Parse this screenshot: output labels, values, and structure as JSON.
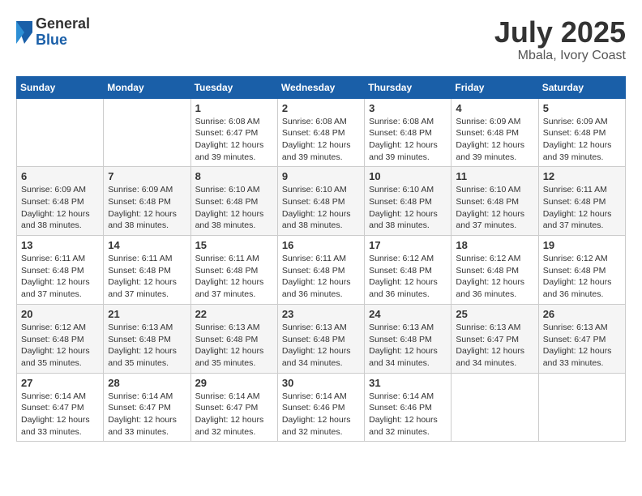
{
  "logo": {
    "general": "General",
    "blue": "Blue"
  },
  "header": {
    "month": "July 2025",
    "location": "Mbala, Ivory Coast"
  },
  "weekdays": [
    "Sunday",
    "Monday",
    "Tuesday",
    "Wednesday",
    "Thursday",
    "Friday",
    "Saturday"
  ],
  "weeks": [
    [
      {
        "day": "",
        "info": ""
      },
      {
        "day": "",
        "info": ""
      },
      {
        "day": "1",
        "info": "Sunrise: 6:08 AM\nSunset: 6:47 PM\nDaylight: 12 hours and 39 minutes."
      },
      {
        "day": "2",
        "info": "Sunrise: 6:08 AM\nSunset: 6:48 PM\nDaylight: 12 hours and 39 minutes."
      },
      {
        "day": "3",
        "info": "Sunrise: 6:08 AM\nSunset: 6:48 PM\nDaylight: 12 hours and 39 minutes."
      },
      {
        "day": "4",
        "info": "Sunrise: 6:09 AM\nSunset: 6:48 PM\nDaylight: 12 hours and 39 minutes."
      },
      {
        "day": "5",
        "info": "Sunrise: 6:09 AM\nSunset: 6:48 PM\nDaylight: 12 hours and 39 minutes."
      }
    ],
    [
      {
        "day": "6",
        "info": "Sunrise: 6:09 AM\nSunset: 6:48 PM\nDaylight: 12 hours and 38 minutes."
      },
      {
        "day": "7",
        "info": "Sunrise: 6:09 AM\nSunset: 6:48 PM\nDaylight: 12 hours and 38 minutes."
      },
      {
        "day": "8",
        "info": "Sunrise: 6:10 AM\nSunset: 6:48 PM\nDaylight: 12 hours and 38 minutes."
      },
      {
        "day": "9",
        "info": "Sunrise: 6:10 AM\nSunset: 6:48 PM\nDaylight: 12 hours and 38 minutes."
      },
      {
        "day": "10",
        "info": "Sunrise: 6:10 AM\nSunset: 6:48 PM\nDaylight: 12 hours and 38 minutes."
      },
      {
        "day": "11",
        "info": "Sunrise: 6:10 AM\nSunset: 6:48 PM\nDaylight: 12 hours and 37 minutes."
      },
      {
        "day": "12",
        "info": "Sunrise: 6:11 AM\nSunset: 6:48 PM\nDaylight: 12 hours and 37 minutes."
      }
    ],
    [
      {
        "day": "13",
        "info": "Sunrise: 6:11 AM\nSunset: 6:48 PM\nDaylight: 12 hours and 37 minutes."
      },
      {
        "day": "14",
        "info": "Sunrise: 6:11 AM\nSunset: 6:48 PM\nDaylight: 12 hours and 37 minutes."
      },
      {
        "day": "15",
        "info": "Sunrise: 6:11 AM\nSunset: 6:48 PM\nDaylight: 12 hours and 37 minutes."
      },
      {
        "day": "16",
        "info": "Sunrise: 6:11 AM\nSunset: 6:48 PM\nDaylight: 12 hours and 36 minutes."
      },
      {
        "day": "17",
        "info": "Sunrise: 6:12 AM\nSunset: 6:48 PM\nDaylight: 12 hours and 36 minutes."
      },
      {
        "day": "18",
        "info": "Sunrise: 6:12 AM\nSunset: 6:48 PM\nDaylight: 12 hours and 36 minutes."
      },
      {
        "day": "19",
        "info": "Sunrise: 6:12 AM\nSunset: 6:48 PM\nDaylight: 12 hours and 36 minutes."
      }
    ],
    [
      {
        "day": "20",
        "info": "Sunrise: 6:12 AM\nSunset: 6:48 PM\nDaylight: 12 hours and 35 minutes."
      },
      {
        "day": "21",
        "info": "Sunrise: 6:13 AM\nSunset: 6:48 PM\nDaylight: 12 hours and 35 minutes."
      },
      {
        "day": "22",
        "info": "Sunrise: 6:13 AM\nSunset: 6:48 PM\nDaylight: 12 hours and 35 minutes."
      },
      {
        "day": "23",
        "info": "Sunrise: 6:13 AM\nSunset: 6:48 PM\nDaylight: 12 hours and 34 minutes."
      },
      {
        "day": "24",
        "info": "Sunrise: 6:13 AM\nSunset: 6:48 PM\nDaylight: 12 hours and 34 minutes."
      },
      {
        "day": "25",
        "info": "Sunrise: 6:13 AM\nSunset: 6:47 PM\nDaylight: 12 hours and 34 minutes."
      },
      {
        "day": "26",
        "info": "Sunrise: 6:13 AM\nSunset: 6:47 PM\nDaylight: 12 hours and 33 minutes."
      }
    ],
    [
      {
        "day": "27",
        "info": "Sunrise: 6:14 AM\nSunset: 6:47 PM\nDaylight: 12 hours and 33 minutes."
      },
      {
        "day": "28",
        "info": "Sunrise: 6:14 AM\nSunset: 6:47 PM\nDaylight: 12 hours and 33 minutes."
      },
      {
        "day": "29",
        "info": "Sunrise: 6:14 AM\nSunset: 6:47 PM\nDaylight: 12 hours and 32 minutes."
      },
      {
        "day": "30",
        "info": "Sunrise: 6:14 AM\nSunset: 6:46 PM\nDaylight: 12 hours and 32 minutes."
      },
      {
        "day": "31",
        "info": "Sunrise: 6:14 AM\nSunset: 6:46 PM\nDaylight: 12 hours and 32 minutes."
      },
      {
        "day": "",
        "info": ""
      },
      {
        "day": "",
        "info": ""
      }
    ]
  ]
}
